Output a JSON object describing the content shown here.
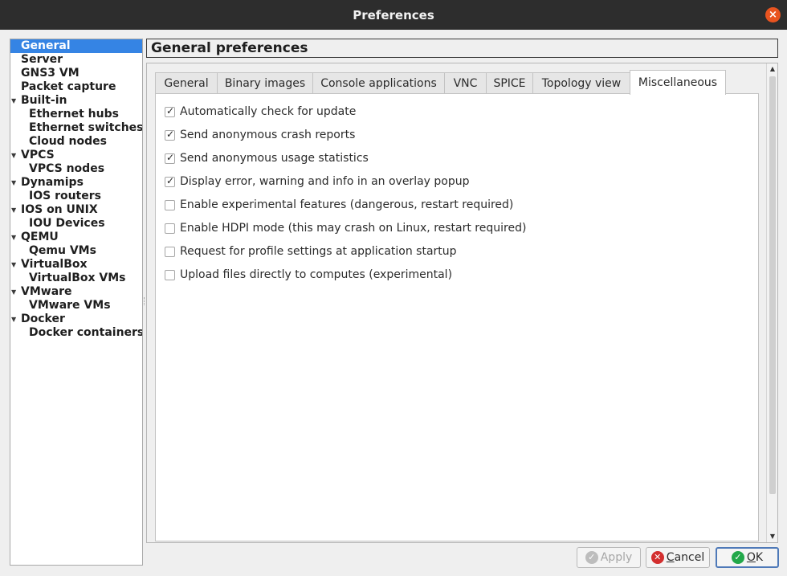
{
  "window": {
    "title": "Preferences",
    "close_glyph": "×"
  },
  "sidebar": {
    "items": [
      {
        "label": "General",
        "level": 0,
        "expandable": false,
        "selected": true
      },
      {
        "label": "Server",
        "level": 0,
        "expandable": false
      },
      {
        "label": "GNS3 VM",
        "level": 0,
        "expandable": false
      },
      {
        "label": "Packet capture",
        "level": 0,
        "expandable": false
      },
      {
        "label": "Built-in",
        "level": 0,
        "expandable": true
      },
      {
        "label": "Ethernet hubs",
        "level": 1,
        "expandable": false
      },
      {
        "label": "Ethernet switches",
        "level": 1,
        "expandable": false
      },
      {
        "label": "Cloud nodes",
        "level": 1,
        "expandable": false
      },
      {
        "label": "VPCS",
        "level": 0,
        "expandable": true
      },
      {
        "label": "VPCS nodes",
        "level": 1,
        "expandable": false
      },
      {
        "label": "Dynamips",
        "level": 0,
        "expandable": true
      },
      {
        "label": "IOS routers",
        "level": 1,
        "expandable": false
      },
      {
        "label": "IOS on UNIX",
        "level": 0,
        "expandable": true
      },
      {
        "label": "IOU Devices",
        "level": 1,
        "expandable": false
      },
      {
        "label": "QEMU",
        "level": 0,
        "expandable": true
      },
      {
        "label": "Qemu VMs",
        "level": 1,
        "expandable": false
      },
      {
        "label": "VirtualBox",
        "level": 0,
        "expandable": true
      },
      {
        "label": "VirtualBox VMs",
        "level": 1,
        "expandable": false
      },
      {
        "label": "VMware",
        "level": 0,
        "expandable": true
      },
      {
        "label": "VMware VMs",
        "level": 1,
        "expandable": false
      },
      {
        "label": "Docker",
        "level": 0,
        "expandable": true
      },
      {
        "label": "Docker containers",
        "level": 1,
        "expandable": false
      }
    ],
    "expand_glyph": "▼"
  },
  "panel": {
    "title": "General preferences"
  },
  "tabs": [
    {
      "label": "General"
    },
    {
      "label": "Binary images"
    },
    {
      "label": "Console applications"
    },
    {
      "label": "VNC"
    },
    {
      "label": "SPICE"
    },
    {
      "label": "Topology view"
    },
    {
      "label": "Miscellaneous",
      "active": true
    }
  ],
  "options": [
    {
      "label": "Automatically check for update",
      "checked": true
    },
    {
      "label": "Send anonymous crash reports",
      "checked": true
    },
    {
      "label": "Send anonymous usage statistics",
      "checked": true
    },
    {
      "label": "Display error, warning and info in an overlay popup",
      "checked": true
    },
    {
      "label": "Enable experimental features (dangerous, restart required)",
      "checked": false
    },
    {
      "label": "Enable HDPI mode (this may crash on Linux, restart required)",
      "checked": false
    },
    {
      "label": "Request for profile settings at application startup",
      "checked": false
    },
    {
      "label": "Upload files directly to computes (experimental)",
      "checked": false
    }
  ],
  "buttons": {
    "apply": {
      "label": "Apply",
      "enabled": false
    },
    "cancel": {
      "label": "Cancel",
      "mnemonic": "C",
      "rest": "ancel"
    },
    "ok": {
      "label": "OK",
      "mnemonic": "O",
      "rest": "K"
    }
  },
  "colors": {
    "accent": "#3584e4",
    "titlebar": "#2d2d2d",
    "close": "#e95420",
    "ok_icon": "#22a84a",
    "cancel_icon": "#d32f2f"
  }
}
